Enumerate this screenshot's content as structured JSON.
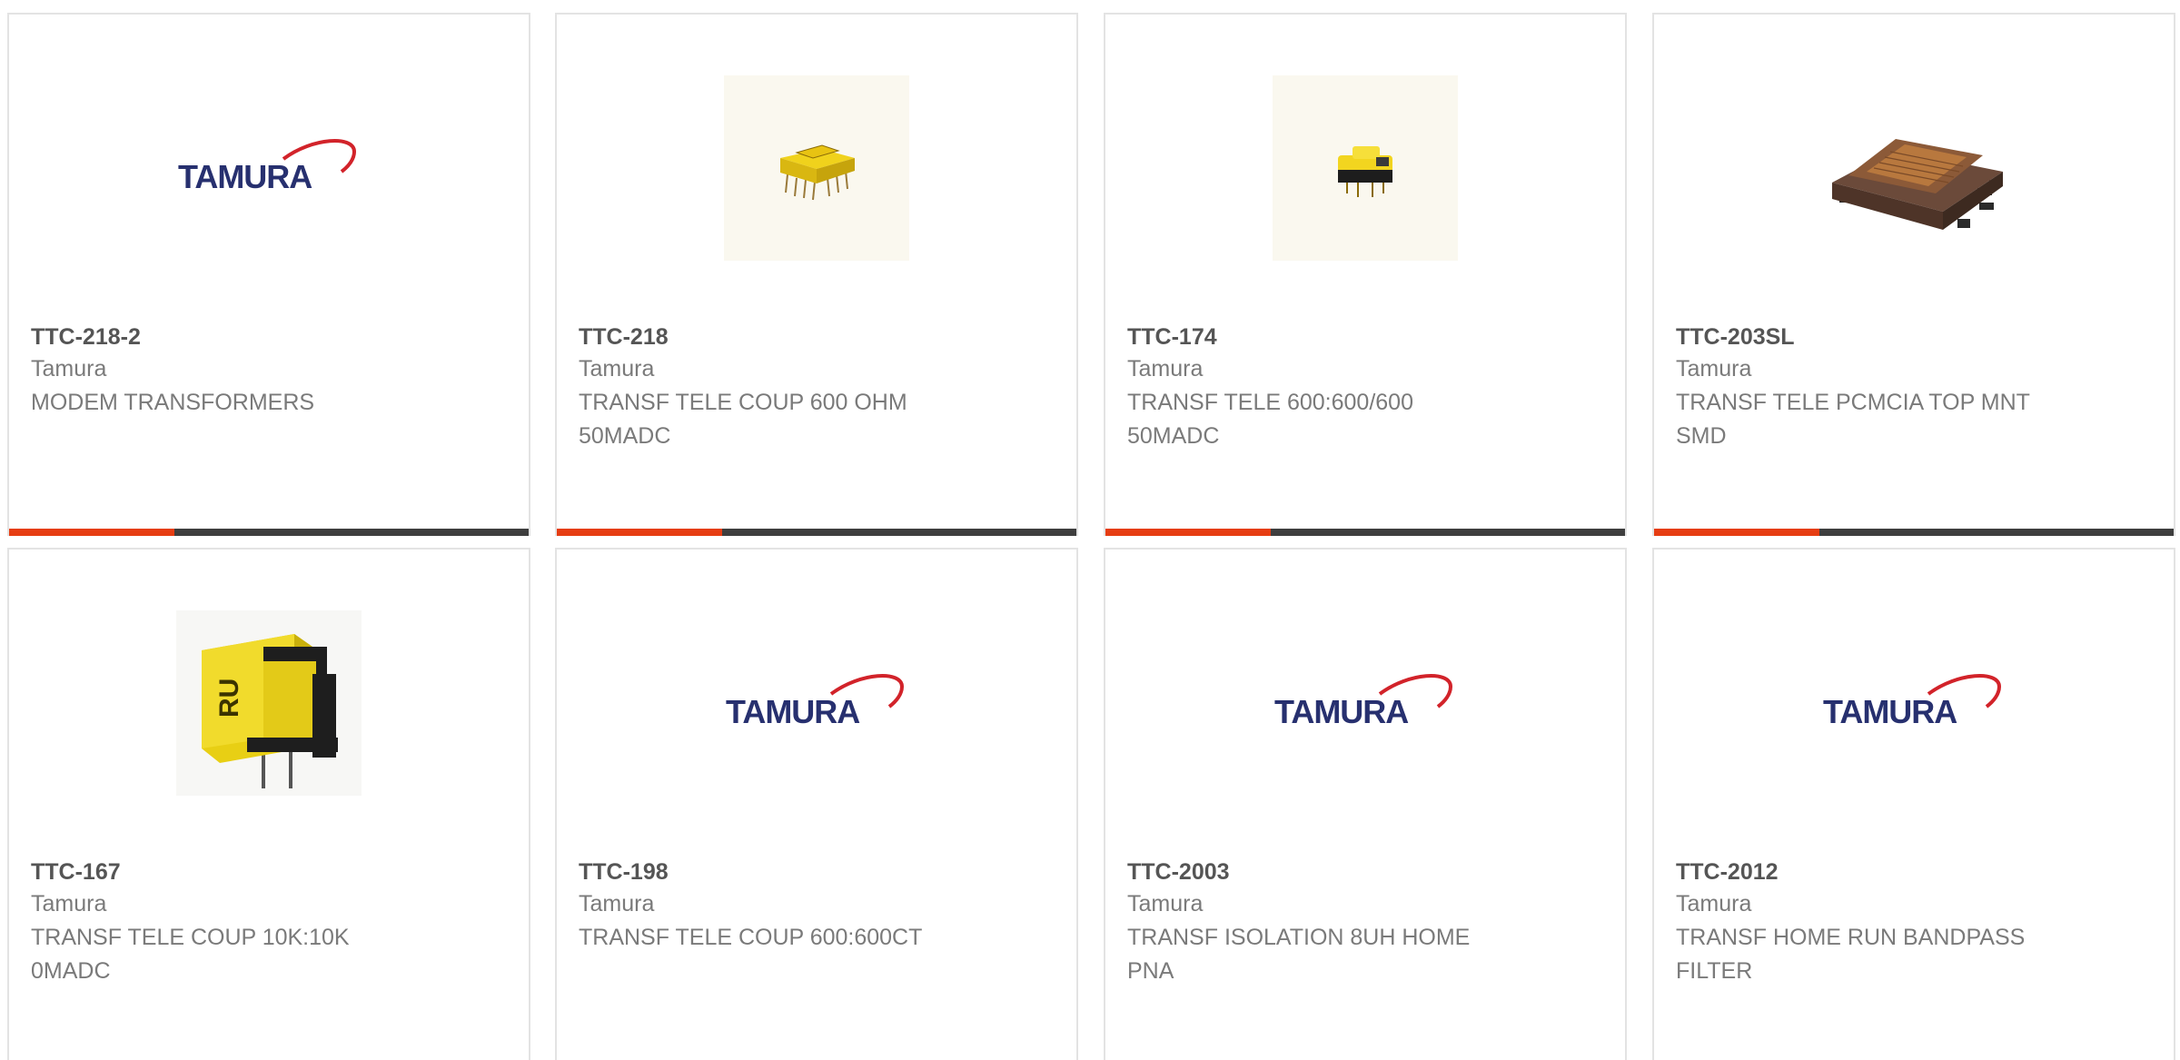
{
  "logo_text": "TAMURA",
  "colors": {
    "accent_orange": "#e63d12",
    "accent_dark": "#3e3e3e",
    "logo_navy": "#27306f",
    "logo_red": "#d2232a"
  },
  "products": [
    {
      "part": "TTC-218-2",
      "manufacturer": "Tamura",
      "desc": "MODEM TRANSFORMERS",
      "image": "tamura-logo"
    },
    {
      "part": "TTC-218",
      "manufacturer": "Tamura",
      "desc": "TRANSF TELE COUP 600 OHM 50MADC",
      "image": "yellow-transformer-dip"
    },
    {
      "part": "TTC-174",
      "manufacturer": "Tamura",
      "desc": "TRANSF TELE 600:600/600 50MADC",
      "image": "yellow-transformer-small"
    },
    {
      "part": "TTC-203SL",
      "manufacturer": "Tamura",
      "desc": "TRANSF TELE PCMCIA TOP MNT SMD",
      "image": "smd-transformer"
    },
    {
      "part": "TTC-167",
      "manufacturer": "Tamura",
      "desc": "TRANSF TELE COUP 10K:10K 0MADC",
      "image": "yellow-transformer-large"
    },
    {
      "part": "TTC-198",
      "manufacturer": "Tamura",
      "desc": "TRANSF TELE COUP 600:600CT",
      "image": "tamura-logo"
    },
    {
      "part": "TTC-2003",
      "manufacturer": "Tamura",
      "desc": "TRANSF ISOLATION 8UH HOME PNA",
      "image": "tamura-logo"
    },
    {
      "part": "TTC-2012",
      "manufacturer": "Tamura",
      "desc": "TRANSF HOME RUN BANDPASS FILTER",
      "image": "tamura-logo"
    }
  ]
}
